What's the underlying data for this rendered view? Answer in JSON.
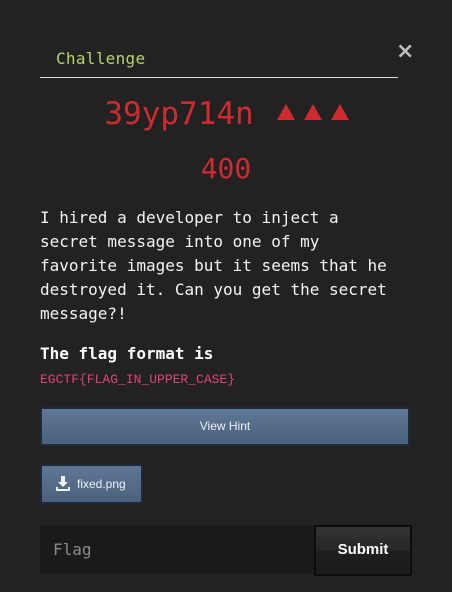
{
  "close_glyph": "×",
  "tabs": [
    {
      "label": "Challenge"
    }
  ],
  "challenge": {
    "name": "39yp714n",
    "difficulty_icons": [
      "triangle-icon",
      "triangle-icon",
      "triangle-icon"
    ],
    "points": "400",
    "description": "I hired a developer to inject a\nsecret message into one of my\nfavorite images but it seems that he\ndestroyed it. Can you get the secret\nmessage?!",
    "flag_heading": "The flag format is",
    "flag_format": "EGCTF{FLAG_IN_UPPER_CASE}"
  },
  "hint_button": {
    "label": "View Hint"
  },
  "files": [
    {
      "label": "fixed.png",
      "icon": "download-icon"
    }
  ],
  "flag_input": {
    "placeholder": "Flag",
    "value": ""
  },
  "submit_button": {
    "label": "Submit"
  },
  "colors": {
    "background": "#222222",
    "accent_red": "#cf2a2f",
    "tab_green": "#b5d56a",
    "flag_pink": "#e2417e",
    "button_blue": "#566e8b"
  }
}
